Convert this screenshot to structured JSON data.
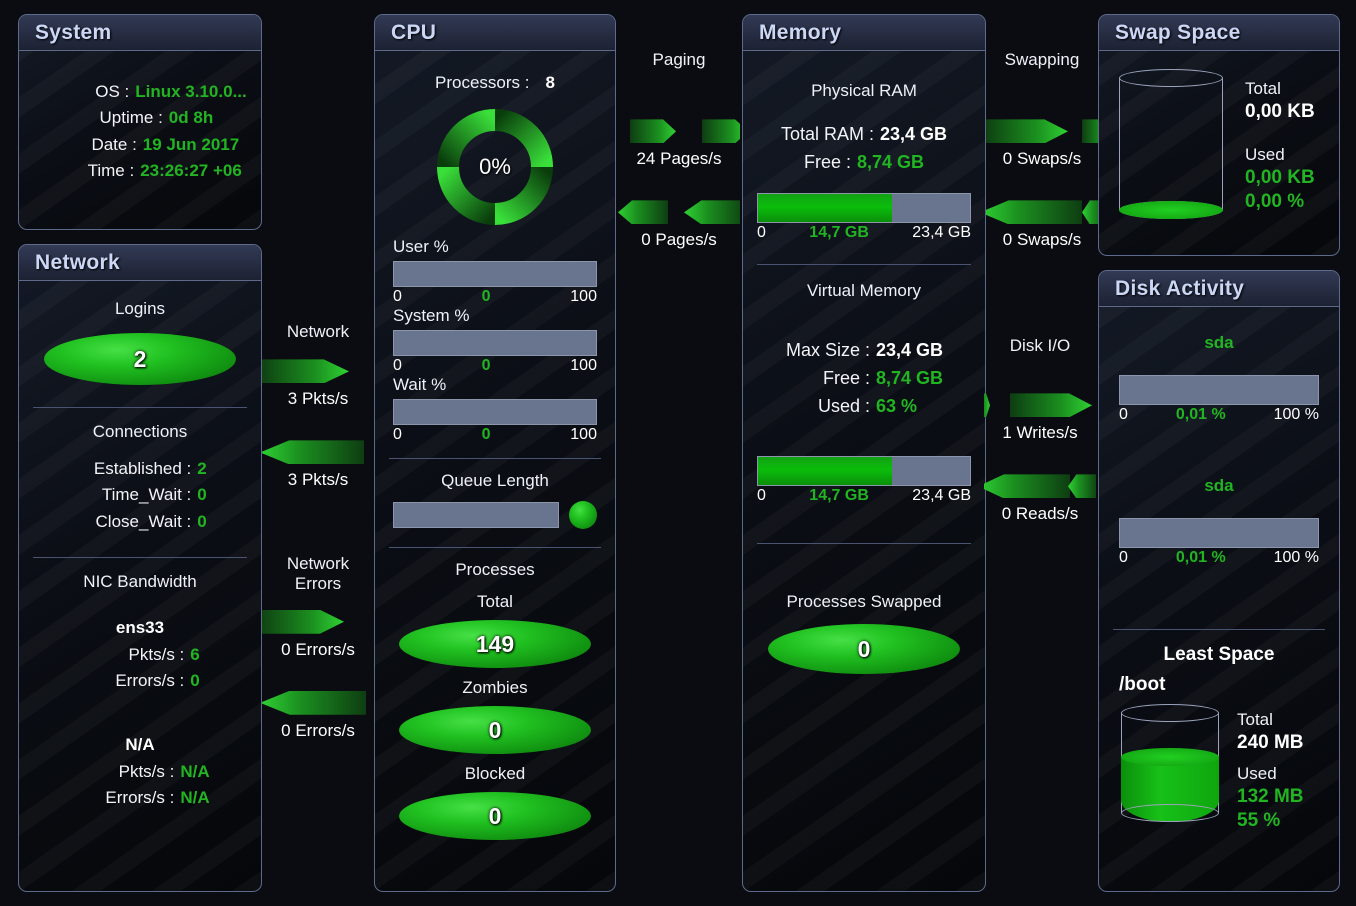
{
  "system": {
    "title": "System",
    "rows": [
      {
        "label": "OS :",
        "value": "Linux 3.10.0..."
      },
      {
        "label": "Uptime :",
        "value": "0d 8h"
      },
      {
        "label": "Date :",
        "value": "19 Jun 2017"
      },
      {
        "label": "Time :",
        "value": "23:26:27 +06"
      }
    ]
  },
  "network": {
    "title": "Network",
    "logins_label": "Logins",
    "logins_value": "2",
    "connections_label": "Connections",
    "connections": [
      {
        "label": "Established :",
        "value": "2"
      },
      {
        "label": "Time_Wait :",
        "value": "0"
      },
      {
        "label": "Close_Wait :",
        "value": "0"
      }
    ],
    "nic_label": "NIC Bandwidth",
    "nics": [
      {
        "name": "ens33",
        "rows": [
          {
            "label": "Pkts/s :",
            "value": "6"
          },
          {
            "label": "Errors/s :",
            "value": "0"
          }
        ]
      },
      {
        "name": "N/A",
        "rows": [
          {
            "label": "Pkts/s :",
            "value": "N/A"
          },
          {
            "label": "Errors/s :",
            "value": "N/A"
          }
        ]
      }
    ]
  },
  "network_flow": {
    "label": "Network",
    "out_value": "3 Pkts/s",
    "in_value": "3 Pkts/s"
  },
  "network_errors_flow": {
    "label_line1": "Network",
    "label_line2": "Errors",
    "out_value": "0 Errors/s",
    "in_value": "0 Errors/s"
  },
  "cpu": {
    "title": "CPU",
    "processors_label": "Processors :",
    "processors_value": "8",
    "gauge_percent": "0%",
    "gauge_value": 0,
    "bars": [
      {
        "label": "User %",
        "lo": "0",
        "mid": "0",
        "hi": "100",
        "percent": 0
      },
      {
        "label": "System %",
        "lo": "0",
        "mid": "0",
        "hi": "100",
        "percent": 0
      },
      {
        "label": "Wait %",
        "lo": "0",
        "mid": "0",
        "hi": "100",
        "percent": 0
      }
    ],
    "queue_label": "Queue Length",
    "queue_percent": 0,
    "processes_label": "Processes",
    "meters": [
      {
        "label": "Total",
        "value": "149"
      },
      {
        "label": "Zombies",
        "value": "0"
      },
      {
        "label": "Blocked",
        "value": "0"
      }
    ]
  },
  "paging_flow": {
    "label": "Paging",
    "in_value": "24 Pages/s",
    "out_value": "0 Pages/s"
  },
  "memory": {
    "title": "Memory",
    "physical_label": "Physical RAM",
    "physical_rows": [
      {
        "label": "Total RAM :",
        "value": "23,4 GB",
        "accent": false
      },
      {
        "label": "Free :",
        "value": "8,74 GB",
        "accent": true
      }
    ],
    "physical_bar": {
      "lo": "0",
      "mid": "14,7 GB",
      "hi": "23,4 GB",
      "percent": 63
    },
    "virtual_label": "Virtual Memory",
    "virtual_rows": [
      {
        "label": "Max Size :",
        "value": "23,4 GB",
        "accent": false
      },
      {
        "label": "Free :",
        "value": "8,74 GB",
        "accent": true
      },
      {
        "label": "Used :",
        "value": "63 %",
        "accent": true
      }
    ],
    "virtual_bar": {
      "lo": "0",
      "mid": "14,7 GB",
      "hi": "23,4 GB",
      "percent": 63
    },
    "swapped_label": "Processes Swapped",
    "swapped_value": "0"
  },
  "swapping_flow": {
    "label": "Swapping",
    "out_value": "0 Swaps/s",
    "in_value": "0 Swaps/s"
  },
  "diskio_flow": {
    "label": "Disk I/O",
    "writes_value": "1 Writes/s",
    "reads_value": "0 Reads/s"
  },
  "swap_space": {
    "title": "Swap Space",
    "total_label": "Total",
    "total_value": "0,00 KB",
    "used_label": "Used",
    "used_value": "0,00 KB",
    "used_percent_text": "0,00 %",
    "fill_percent": 0
  },
  "disk_activity": {
    "title": "Disk Activity",
    "disks": [
      {
        "name": "sda",
        "lo": "0",
        "mid": "0,01 %",
        "hi": "100 %",
        "percent": 0
      },
      {
        "name": "sda",
        "lo": "0",
        "mid": "0,01 %",
        "hi": "100 %",
        "percent": 0
      }
    ],
    "least_space_label": "Least Space",
    "mount": "/boot",
    "total_label": "Total",
    "total_value": "240 MB",
    "used_label": "Used",
    "used_value": "132 MB",
    "used_percent_text": "55 %",
    "fill_percent": 55
  }
}
